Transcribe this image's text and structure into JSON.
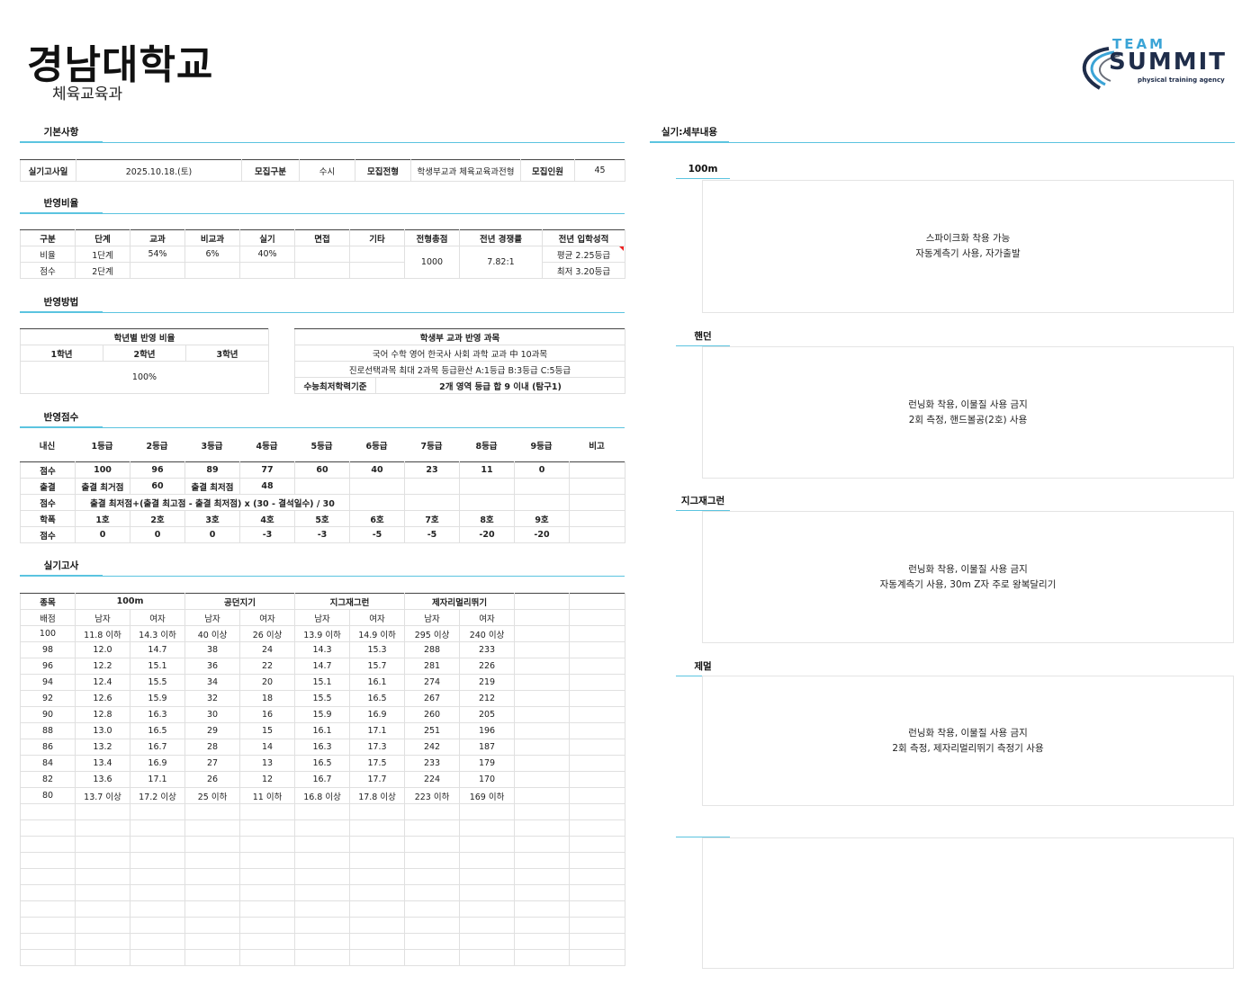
{
  "header": {
    "university": "경남대학교",
    "department": "체육교육과",
    "logo": {
      "line1": "TEAM",
      "line2": "SUMMIT",
      "line3": "physical training agency"
    }
  },
  "sections": {
    "basic": "기본사항",
    "ratio": "반영비율",
    "method": "반영방법",
    "score": "반영점수",
    "practical": "실기고사",
    "details": "실기:세부내용"
  },
  "basic": {
    "cells": [
      "실기고사일",
      "2025.10.18.(토)",
      "모집구분",
      "수시",
      "모집전형",
      "학생부교과 체육교육과전형",
      "모집인원",
      "45"
    ]
  },
  "ratio": {
    "header": [
      "구분",
      "단계",
      "교과",
      "비교과",
      "실기",
      "면접",
      "기타",
      "전형총점",
      "전년 경쟁률",
      "전년 입학성적"
    ],
    "row1": [
      "비율",
      "1단계",
      "54%",
      "6%",
      "40%",
      "",
      ""
    ],
    "row2": [
      "점수",
      "2단계",
      "",
      "",
      "",
      "",
      ""
    ],
    "total": "1000",
    "competition": "7.82:1",
    "grade_avg": "평균 2.25등급",
    "grade_min": "최저 3.20등급"
  },
  "method": {
    "grade_title": "학년별 반영 비율",
    "grades": [
      "1학년",
      "2학년",
      "3학년"
    ],
    "grade_value": "100%",
    "subject_title": "학생부 교과 반영 과목",
    "subject_line1": "국어 수학 영어 한국사 사회 과학 교과 中 10과목",
    "subject_line2": "진로선택과목 최대 2과목 등급환산 A:1등급 B:3등급 C:5등급",
    "csat_label": "수능최저학력기준",
    "csat_value": "2개 영역 등급 합 9 이내 (탐구1)"
  },
  "score": {
    "header": [
      "내신",
      "1등급",
      "2등급",
      "3등급",
      "4등급",
      "5등급",
      "6등급",
      "7등급",
      "8등급",
      "9등급",
      "비고"
    ],
    "score_row": [
      "점수",
      "100",
      "96",
      "89",
      "77",
      "60",
      "40",
      "23",
      "11",
      "0",
      ""
    ],
    "attendance": [
      "출결",
      "출결 최거점",
      "60",
      "출결 최저점",
      "48"
    ],
    "attendance_formula_label": "점수",
    "attendance_formula": "출결 최저점+(출결 최고점 - 출결 최저점) x (30 - 결석일수) / 30",
    "absence_header": [
      "학폭",
      "1호",
      "2호",
      "3호",
      "4호",
      "5호",
      "6호",
      "7호",
      "8호",
      "9호",
      ""
    ],
    "absence_score": [
      "점수",
      "0",
      "0",
      "0",
      "-3",
      "-3",
      "-5",
      "-5",
      "-20",
      "-20",
      ""
    ]
  },
  "practical": {
    "events": [
      "종목",
      "100m",
      "공던지기",
      "지그재그런",
      "제자리멀리뛰기"
    ],
    "sub_header": [
      "배점",
      "남자",
      "여자",
      "남자",
      "여자",
      "남자",
      "여자",
      "남자",
      "여자"
    ],
    "rows": [
      [
        "100",
        "11.8 이하",
        "14.3 이하",
        "40 이상",
        "26 이상",
        "13.9 이하",
        "14.9 이하",
        "295 이상",
        "240 이상"
      ],
      [
        "98",
        "12.0",
        "14.7",
        "38",
        "24",
        "14.3",
        "15.3",
        "288",
        "233"
      ],
      [
        "96",
        "12.2",
        "15.1",
        "36",
        "22",
        "14.7",
        "15.7",
        "281",
        "226"
      ],
      [
        "94",
        "12.4",
        "15.5",
        "34",
        "20",
        "15.1",
        "16.1",
        "274",
        "219"
      ],
      [
        "92",
        "12.6",
        "15.9",
        "32",
        "18",
        "15.5",
        "16.5",
        "267",
        "212"
      ],
      [
        "90",
        "12.8",
        "16.3",
        "30",
        "16",
        "15.9",
        "16.9",
        "260",
        "205"
      ],
      [
        "88",
        "13.0",
        "16.5",
        "29",
        "15",
        "16.1",
        "17.1",
        "251",
        "196"
      ],
      [
        "86",
        "13.2",
        "16.7",
        "28",
        "14",
        "16.3",
        "17.3",
        "242",
        "187"
      ],
      [
        "84",
        "13.4",
        "16.9",
        "27",
        "13",
        "16.5",
        "17.5",
        "233",
        "179"
      ],
      [
        "82",
        "13.6",
        "17.1",
        "26",
        "12",
        "16.7",
        "17.7",
        "224",
        "170"
      ],
      [
        "80",
        "13.7 이상",
        "17.2 이상",
        "25 이하",
        "11 이하",
        "16.8 이상",
        "17.8 이상",
        "223 이하",
        "169 이하"
      ]
    ]
  },
  "details": [
    {
      "event": "100m",
      "line1": "스파이크화 착용 가능",
      "line2": "자동계측기 사용, 자가출발"
    },
    {
      "event": "핸던",
      "line1": "런닝화 착용, 이물질 사용 금지",
      "line2": "2회 측정, 핸드볼공(2호) 사용"
    },
    {
      "event": "지그재그런",
      "line1": "런닝화 착용, 이물질 사용 금지",
      "line2": "자동계측기 사용, 30m Z자 주로 왕복달리기"
    },
    {
      "event": "제멀",
      "line1": "런닝화 착용, 이물질 사용 금지",
      "line2": "2회 측정, 제자리멀리뛰기 측정기 사용"
    },
    {
      "event": "",
      "line1": "",
      "line2": ""
    }
  ]
}
